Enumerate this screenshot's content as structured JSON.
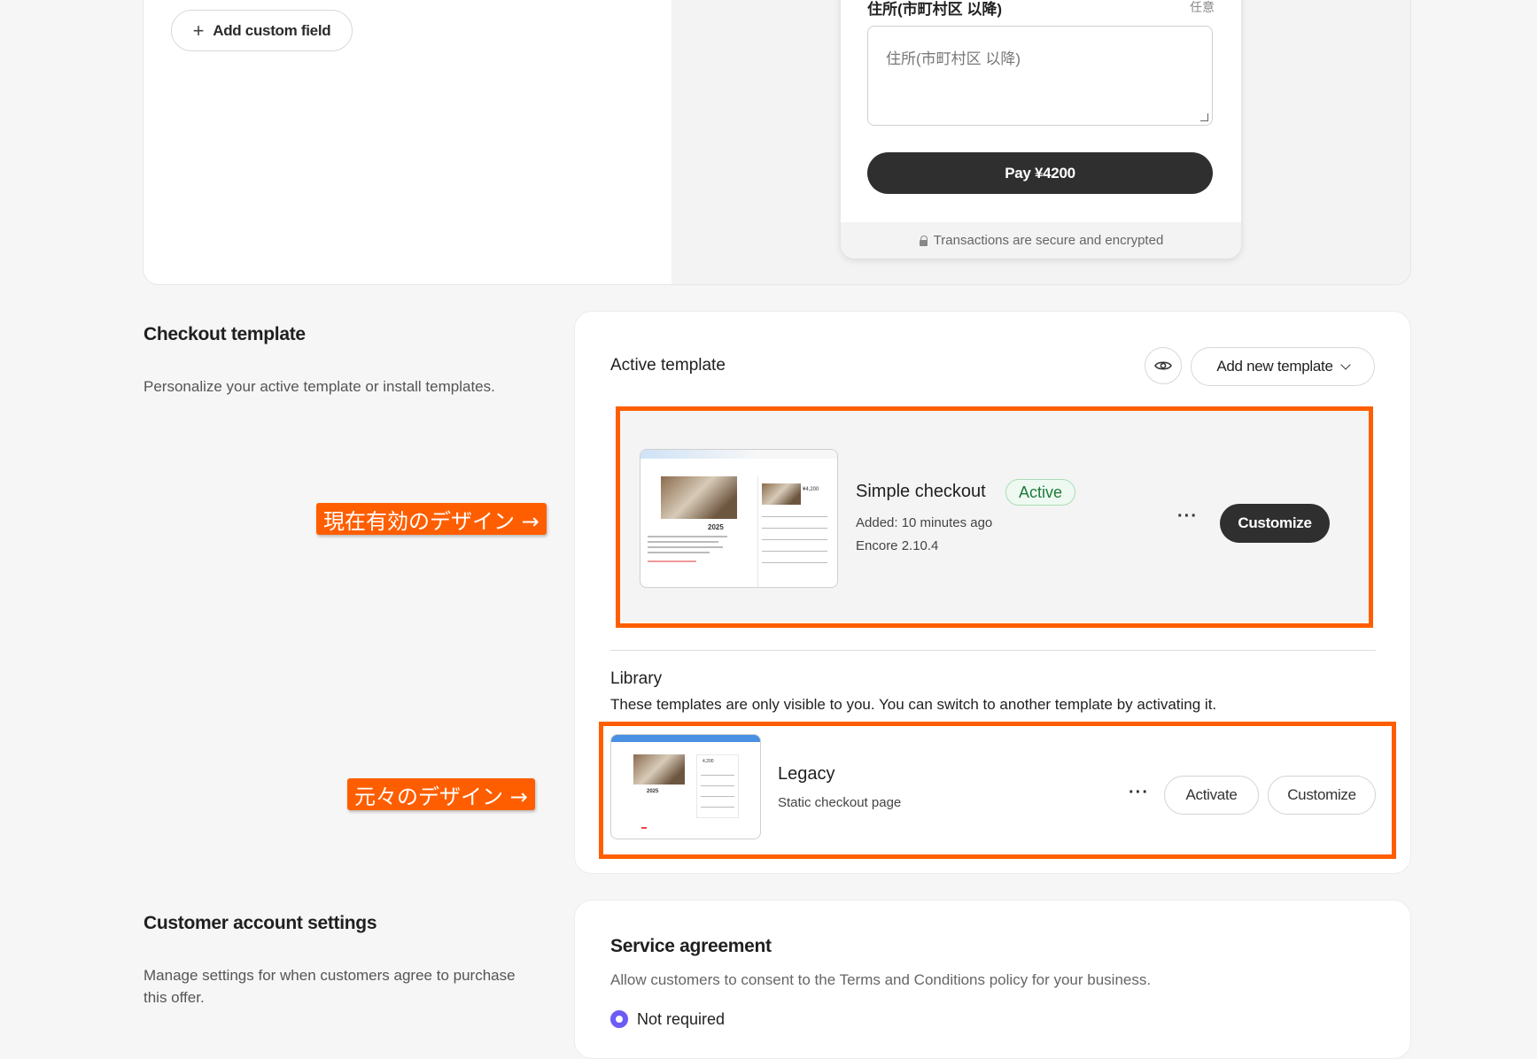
{
  "custom_fields": {
    "add_button_label": "Add custom field"
  },
  "checkout_preview": {
    "address_label": "住所(市町村区 以降)",
    "optional_label": "任意",
    "address_placeholder": "住所(市町村区 以降)",
    "pay_button": "Pay ¥4200",
    "secure_text": "Transactions are secure and encrypted"
  },
  "checkout_template": {
    "title": "Checkout template",
    "description": "Personalize your active template or install templates.",
    "active_label": "Active template",
    "add_new_template": "Add new template",
    "active": {
      "name": "Simple checkout",
      "badge": "Active",
      "added": "Added: 10 minutes ago",
      "version": "Encore 2.10.4",
      "more": "···",
      "customize": "Customize",
      "thumb_year": "2025",
      "thumb_price": "¥4,200"
    },
    "library_title": "Library",
    "library_desc": "These templates are only visible to you. You can switch to another template by activating it.",
    "legacy": {
      "name": "Legacy",
      "subtitle": "Static checkout page",
      "more": "···",
      "activate": "Activate",
      "customize": "Customize",
      "thumb_year": "2025",
      "thumb_price": "4,200"
    }
  },
  "annotations": {
    "current_design": "現在有効のデザイン →",
    "original_design": "元々のデザイン →"
  },
  "customer_account": {
    "title": "Customer account settings",
    "description": "Manage settings for when customers agree to purchase this offer."
  },
  "service_agreement": {
    "title": "Service agreement",
    "description": "Allow customers to consent to the Terms and Conditions policy for your business.",
    "option_selected": "Not required"
  },
  "colors": {
    "accent_orange": "#ff5e00",
    "radio_purple": "#6b5cf5",
    "active_green": "#1d7a3a",
    "dark_button": "#2f2f2f"
  }
}
